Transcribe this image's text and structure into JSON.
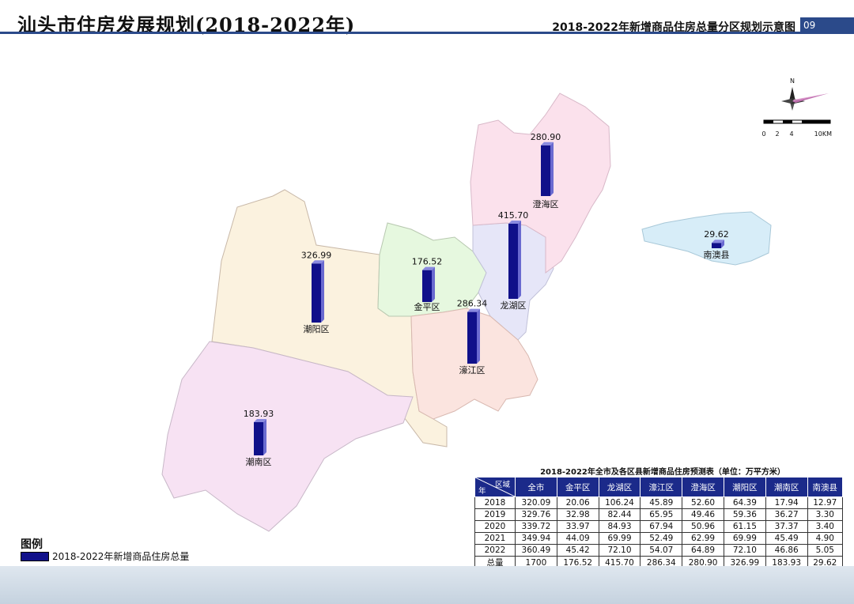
{
  "header": {
    "title": "汕头市住房发展规划(2018-2022年)",
    "subtitle": "2018-2022年新增商品住房总量分区规划示意图",
    "page_number": "09"
  },
  "compass": {
    "north": "N",
    "scale_labels": [
      "0",
      "2",
      "4",
      "10KM"
    ]
  },
  "districts": [
    {
      "id": "chaoyang",
      "name": "潮阳区",
      "value": "326.99",
      "color": "#fbf2df"
    },
    {
      "id": "chaonan",
      "name": "潮南区",
      "value": "183.93",
      "color": "#f7e2f3"
    },
    {
      "id": "jinping",
      "name": "金平区",
      "value": "176.52",
      "color": "#e6f8df"
    },
    {
      "id": "longhu",
      "name": "龙湖区",
      "value": "415.70",
      "color": "#e6e6f8"
    },
    {
      "id": "chenghai",
      "name": "澄海区",
      "value": "280.90",
      "color": "#fbe1ec"
    },
    {
      "id": "haojiang",
      "name": "濠江区",
      "value": "286.34",
      "color": "#fbe4df"
    },
    {
      "id": "nanao",
      "name": "南澳县",
      "value": "29.62",
      "color": "#d7edf8"
    }
  ],
  "bar_color": "#10108a",
  "table": {
    "caption": "2018-2022年全市及各区县新增商品住房预测表（单位：万平方米）",
    "corner_top": "区域",
    "corner_bottom": "年",
    "headers": [
      "全市",
      "金平区",
      "龙湖区",
      "濠江区",
      "澄海区",
      "潮阳区",
      "潮南区",
      "南澳县"
    ],
    "rows": [
      {
        "year": "2018",
        "cells": [
          "320.09",
          "20.06",
          "106.24",
          "45.89",
          "52.60",
          "64.39",
          "17.94",
          "12.97"
        ]
      },
      {
        "year": "2019",
        "cells": [
          "329.76",
          "32.98",
          "82.44",
          "65.95",
          "49.46",
          "59.36",
          "36.27",
          "3.30"
        ]
      },
      {
        "year": "2020",
        "cells": [
          "339.72",
          "33.97",
          "84.93",
          "67.94",
          "50.96",
          "61.15",
          "37.37",
          "3.40"
        ]
      },
      {
        "year": "2021",
        "cells": [
          "349.94",
          "44.09",
          "69.99",
          "52.49",
          "62.99",
          "69.99",
          "45.49",
          "4.90"
        ]
      },
      {
        "year": "2022",
        "cells": [
          "360.49",
          "45.42",
          "72.10",
          "54.07",
          "64.89",
          "72.10",
          "46.86",
          "5.05"
        ]
      },
      {
        "year": "总量",
        "cells": [
          "1700",
          "176.52",
          "415.70",
          "286.34",
          "280.90",
          "326.99",
          "183.93",
          "29.62"
        ]
      }
    ]
  },
  "legend": {
    "title": "图例",
    "item": "2018-2022年新增商品住房总量"
  }
}
